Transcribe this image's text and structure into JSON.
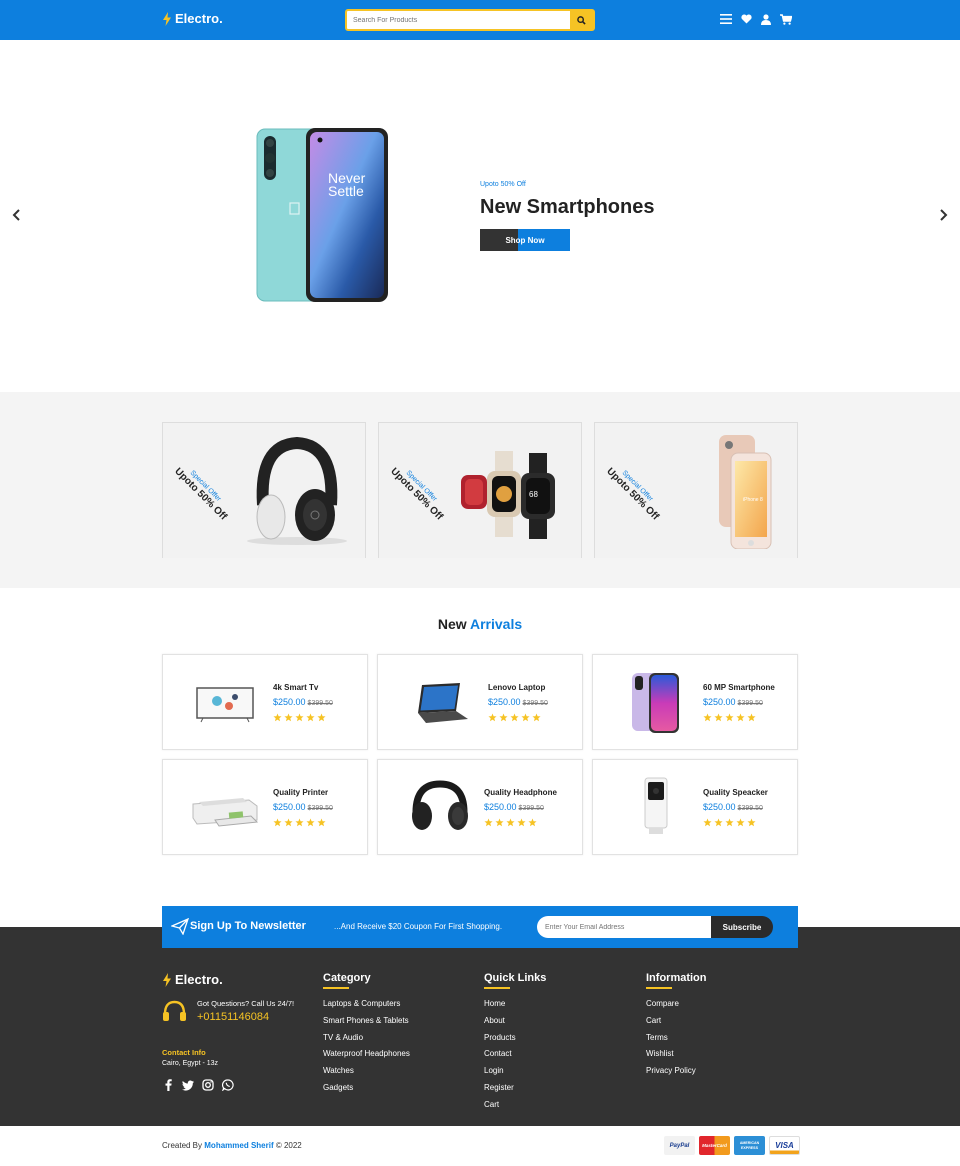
{
  "brand": {
    "name": "Electro."
  },
  "colors": {
    "primary": "#0d7fde",
    "accent": "#f6c324",
    "dark": "#333333"
  },
  "header": {
    "search_placeholder": "Search For Products",
    "icons": [
      "search-icon",
      "menu-icon",
      "heart-icon",
      "user-icon",
      "cart-icon"
    ]
  },
  "hero": {
    "subtitle": "Upoto 50% Off",
    "title": "New Smartphones",
    "button": "Shop Now",
    "phone_text": "Never Settle"
  },
  "offers": [
    {
      "tag": "Special Offer",
      "discount": "Upoto 50% Off"
    },
    {
      "tag": "Special Offer",
      "discount": "Upoto 50% Off"
    },
    {
      "tag": "Special Offer",
      "discount": "Upoto 50% Off"
    }
  ],
  "arrivals": {
    "title_a": "New",
    "title_b": "Arrivals",
    "products": [
      {
        "name": "4k Smart Tv",
        "price": "$250.00",
        "old_price": "$399.50",
        "rating": 5
      },
      {
        "name": "Lenovo Laptop",
        "price": "$250.00",
        "old_price": "$399.50",
        "rating": 5
      },
      {
        "name": "60 MP Smartphone",
        "price": "$250.00",
        "old_price": "$399.50",
        "rating": 5
      },
      {
        "name": "Quality Printer",
        "price": "$250.00",
        "old_price": "$399.50",
        "rating": 5
      },
      {
        "name": "Quality Headphone",
        "price": "$250.00",
        "old_price": "$399.50",
        "rating": 5
      },
      {
        "name": "Quality Speacker",
        "price": "$250.00",
        "old_price": "$399.50",
        "rating": 5
      }
    ]
  },
  "newsletter": {
    "title": "Sign Up To Newsletter",
    "text": "...And Receive $20 Coupon For First Shopping.",
    "placeholder": "Enter Your Email Address",
    "button": "Subscribe"
  },
  "footer": {
    "help_question": "Got Questions? Call Us 24/7!",
    "phone": "+01151146084",
    "contact_heading": "Contact Info",
    "contact_address": "Cairo, Egypt - 13z",
    "category": {
      "heading": "Category",
      "links": [
        "Laptops & Computers",
        "Smart Phones & Tablets",
        "TV & Audio",
        "Waterproof Headphones",
        "Watches",
        "Gadgets"
      ]
    },
    "quick_links": {
      "heading": "Quick Links",
      "links": [
        "Home",
        "About",
        "Products",
        "Contact",
        "Login",
        "Register",
        "Cart"
      ]
    },
    "information": {
      "heading": "Information",
      "links": [
        "Compare",
        "Cart",
        "Terms",
        "Wishlist",
        "Privacy Policy"
      ]
    }
  },
  "bottom": {
    "credit_prefix": "Created By",
    "author": "Mohammed Sherif",
    "credit_suffix": "© 2022",
    "payments": [
      "PayPal",
      "MasterCard",
      "AMERICAN EXPRESS",
      "VISA"
    ]
  }
}
